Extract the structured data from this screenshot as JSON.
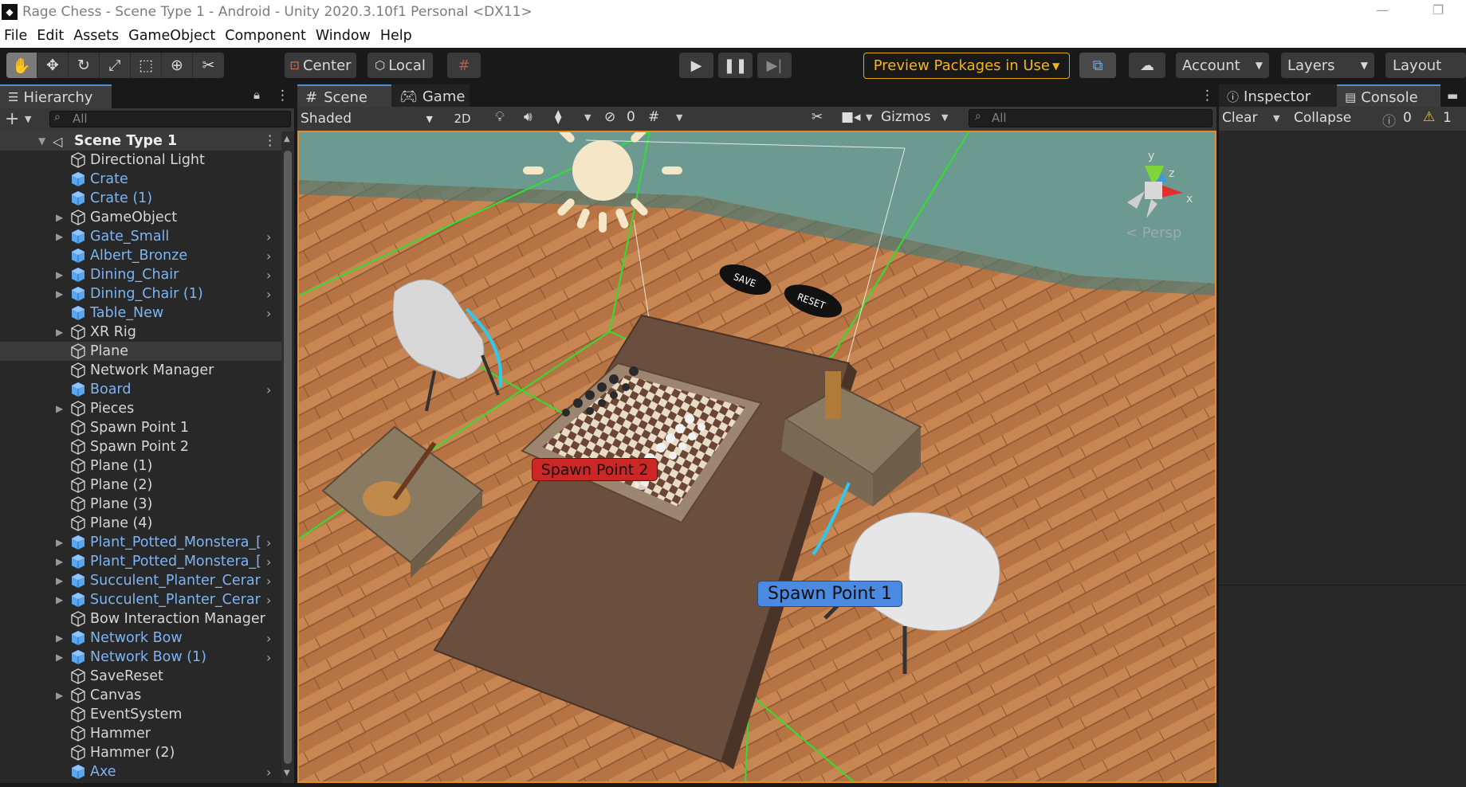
{
  "titlebar": {
    "title": "Rage Chess - Scene Type 1 - Android - Unity 2020.3.10f1 Personal <DX11>",
    "minimize": "—",
    "maximize": "❐"
  },
  "menu": [
    "File",
    "Edit",
    "Assets",
    "GameObject",
    "Component",
    "Window",
    "Help"
  ],
  "toolbar": {
    "pivot": "Center",
    "space": "Local",
    "preview_packages": "Preview Packages in Use",
    "account": "Account",
    "layers": "Layers",
    "layout": "Layout"
  },
  "hierarchy": {
    "tab": "Hierarchy",
    "search_placeholder": "All",
    "root": "Scene Type 1",
    "items": [
      {
        "label": "Directional Light",
        "color": "white",
        "expandable": false,
        "chevron": false,
        "prefab": false
      },
      {
        "label": "Crate",
        "color": "blue",
        "expandable": false,
        "chevron": false,
        "prefab": true
      },
      {
        "label": "Crate (1)",
        "color": "blue",
        "expandable": false,
        "chevron": false,
        "prefab": true
      },
      {
        "label": "GameObject",
        "color": "white",
        "expandable": true,
        "chevron": false,
        "prefab": false
      },
      {
        "label": "Gate_Small",
        "color": "blue",
        "expandable": true,
        "chevron": true,
        "prefab": true
      },
      {
        "label": "Albert_Bronze",
        "color": "blue",
        "expandable": false,
        "chevron": true,
        "prefab": true
      },
      {
        "label": "Dining_Chair",
        "color": "blue",
        "expandable": true,
        "chevron": true,
        "prefab": true
      },
      {
        "label": "Dining_Chair (1)",
        "color": "blue",
        "expandable": true,
        "chevron": true,
        "prefab": true
      },
      {
        "label": "Table_New",
        "color": "blue",
        "expandable": false,
        "chevron": true,
        "prefab": true
      },
      {
        "label": "XR Rig",
        "color": "white",
        "expandable": true,
        "chevron": false,
        "prefab": false
      },
      {
        "label": "Plane",
        "color": "white",
        "expandable": false,
        "chevron": false,
        "prefab": false,
        "selected": true
      },
      {
        "label": "Network Manager",
        "color": "white",
        "expandable": false,
        "chevron": false,
        "prefab": false
      },
      {
        "label": "Board",
        "color": "blue",
        "expandable": false,
        "chevron": true,
        "prefab": true
      },
      {
        "label": "Pieces",
        "color": "white",
        "expandable": true,
        "chevron": false,
        "prefab": false
      },
      {
        "label": "Spawn Point 1",
        "color": "white",
        "expandable": false,
        "chevron": false,
        "prefab": false
      },
      {
        "label": "Spawn Point 2",
        "color": "white",
        "expandable": false,
        "chevron": false,
        "prefab": false
      },
      {
        "label": "Plane (1)",
        "color": "white",
        "expandable": false,
        "chevron": false,
        "prefab": false
      },
      {
        "label": "Plane (2)",
        "color": "white",
        "expandable": false,
        "chevron": false,
        "prefab": false
      },
      {
        "label": "Plane (3)",
        "color": "white",
        "expandable": false,
        "chevron": false,
        "prefab": false
      },
      {
        "label": "Plane (4)",
        "color": "white",
        "expandable": false,
        "chevron": false,
        "prefab": false
      },
      {
        "label": "Plant_Potted_Monstera_[",
        "color": "blue",
        "expandable": true,
        "chevron": true,
        "prefab": true
      },
      {
        "label": "Plant_Potted_Monstera_[",
        "color": "blue",
        "expandable": true,
        "chevron": true,
        "prefab": true
      },
      {
        "label": "Succulent_Planter_Cerar",
        "color": "blue",
        "expandable": true,
        "chevron": true,
        "prefab": true
      },
      {
        "label": "Succulent_Planter_Cerar",
        "color": "blue",
        "expandable": true,
        "chevron": true,
        "prefab": true
      },
      {
        "label": "Bow Interaction Manager",
        "color": "white",
        "expandable": false,
        "chevron": false,
        "prefab": false
      },
      {
        "label": "Network Bow",
        "color": "blue",
        "expandable": true,
        "chevron": true,
        "prefab": true
      },
      {
        "label": "Network Bow (1)",
        "color": "blue",
        "expandable": true,
        "chevron": true,
        "prefab": true
      },
      {
        "label": "SaveReset",
        "color": "white",
        "expandable": false,
        "chevron": false,
        "prefab": false
      },
      {
        "label": "Canvas",
        "color": "white",
        "expandable": true,
        "chevron": false,
        "prefab": false
      },
      {
        "label": "EventSystem",
        "color": "white",
        "expandable": false,
        "chevron": false,
        "prefab": false
      },
      {
        "label": "Hammer",
        "color": "white",
        "expandable": false,
        "chevron": false,
        "prefab": false
      },
      {
        "label": "Hammer (2)",
        "color": "white",
        "expandable": false,
        "chevron": false,
        "prefab": false
      },
      {
        "label": "Axe",
        "color": "blue",
        "expandable": false,
        "chevron": true,
        "prefab": true
      }
    ]
  },
  "scene": {
    "tab_scene": "Scene",
    "tab_game": "Game",
    "draw_mode": "Shaded",
    "mode_2d": "2D",
    "hidden_count": "0",
    "gizmos": "Gizmos",
    "search_placeholder": "All",
    "persp": "< Persp",
    "gizmo_axes": {
      "y": "y",
      "z": "z",
      "x": "x"
    },
    "spawn_point_1": "Spawn Point 1",
    "spawn_point_2": "Spawn Point 2",
    "button_save": "SAVE",
    "button_reset": "RESET"
  },
  "right_panel": {
    "tab_inspector": "Inspector",
    "tab_console": "Console",
    "clear": "Clear",
    "collapse": "Collapse",
    "error_count": "0",
    "warning_count": "1"
  },
  "colors": {
    "accent_blue": "#4c8fd6",
    "prefab_blue": "#7cb4f4",
    "scene_border": "#e48a2a",
    "preview_yellow": "#f2b51c"
  }
}
